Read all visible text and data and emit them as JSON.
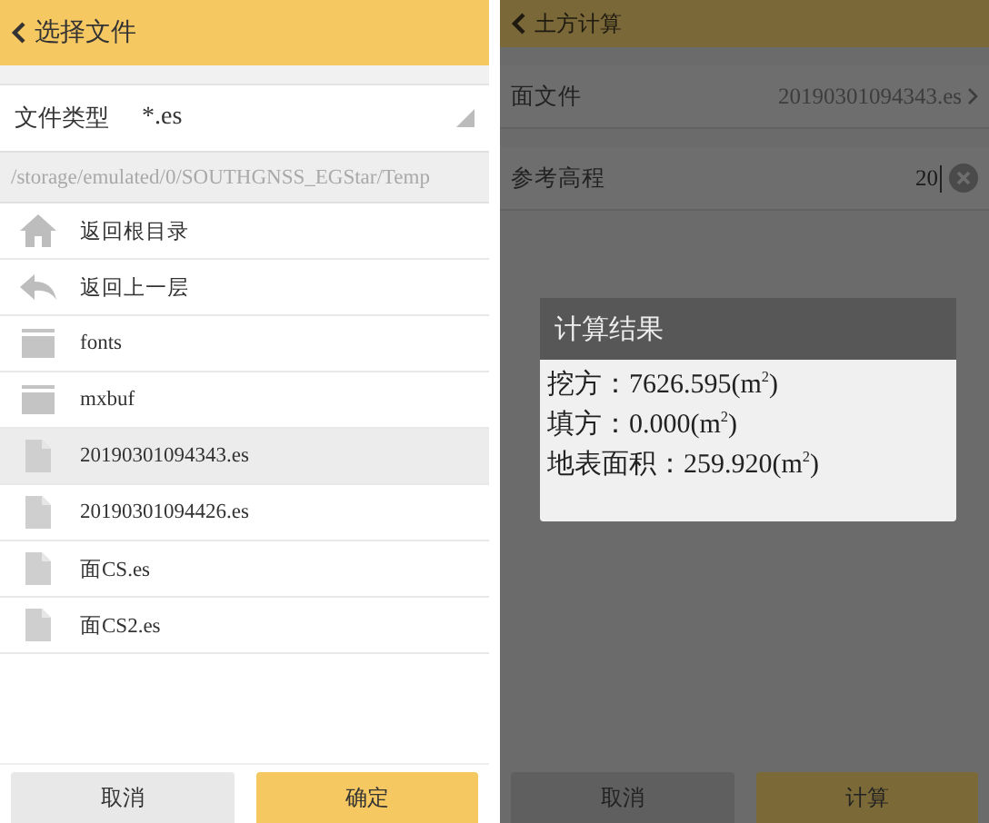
{
  "file_picker": {
    "title": "选择文件",
    "file_type": {
      "label": "文件类型",
      "value": "*.es"
    },
    "path": "/storage/emulated/0/SOUTHGNSS_EGStar/Temp",
    "items": [
      {
        "kind": "home",
        "name": "返回根目录",
        "selected": false
      },
      {
        "kind": "up",
        "name": "返回上一层",
        "selected": false
      },
      {
        "kind": "folder",
        "name": "fonts",
        "selected": false
      },
      {
        "kind": "folder",
        "name": "mxbuf",
        "selected": false
      },
      {
        "kind": "file",
        "name": "20190301094343.es",
        "selected": true
      },
      {
        "kind": "file",
        "name": "20190301094426.es",
        "selected": false
      },
      {
        "kind": "file",
        "name": "面CS.es",
        "selected": false
      },
      {
        "kind": "file",
        "name": "面CS2.es",
        "selected": false
      }
    ],
    "buttons": [
      {
        "label": "取消",
        "kind": "secondary"
      },
      {
        "label": "确定",
        "kind": "primary"
      }
    ]
  },
  "earthwork": {
    "title": "土方计算",
    "rows": [
      {
        "kind": "link",
        "label": "面文件",
        "value": "20190301094343.es"
      },
      {
        "kind": "input",
        "label": "参考高程",
        "value": "20"
      }
    ],
    "dialog": {
      "title": "计算结果",
      "lines": [
        "挖方：7626.595(m$^{2}$)",
        "填方：0.000(m$^{2}$)",
        "地表面积：259.920(m$^{2}$)"
      ]
    },
    "buttons": [
      {
        "label": "取消",
        "kind": "secondary"
      },
      {
        "label": "计算",
        "kind": "primary"
      }
    ]
  }
}
